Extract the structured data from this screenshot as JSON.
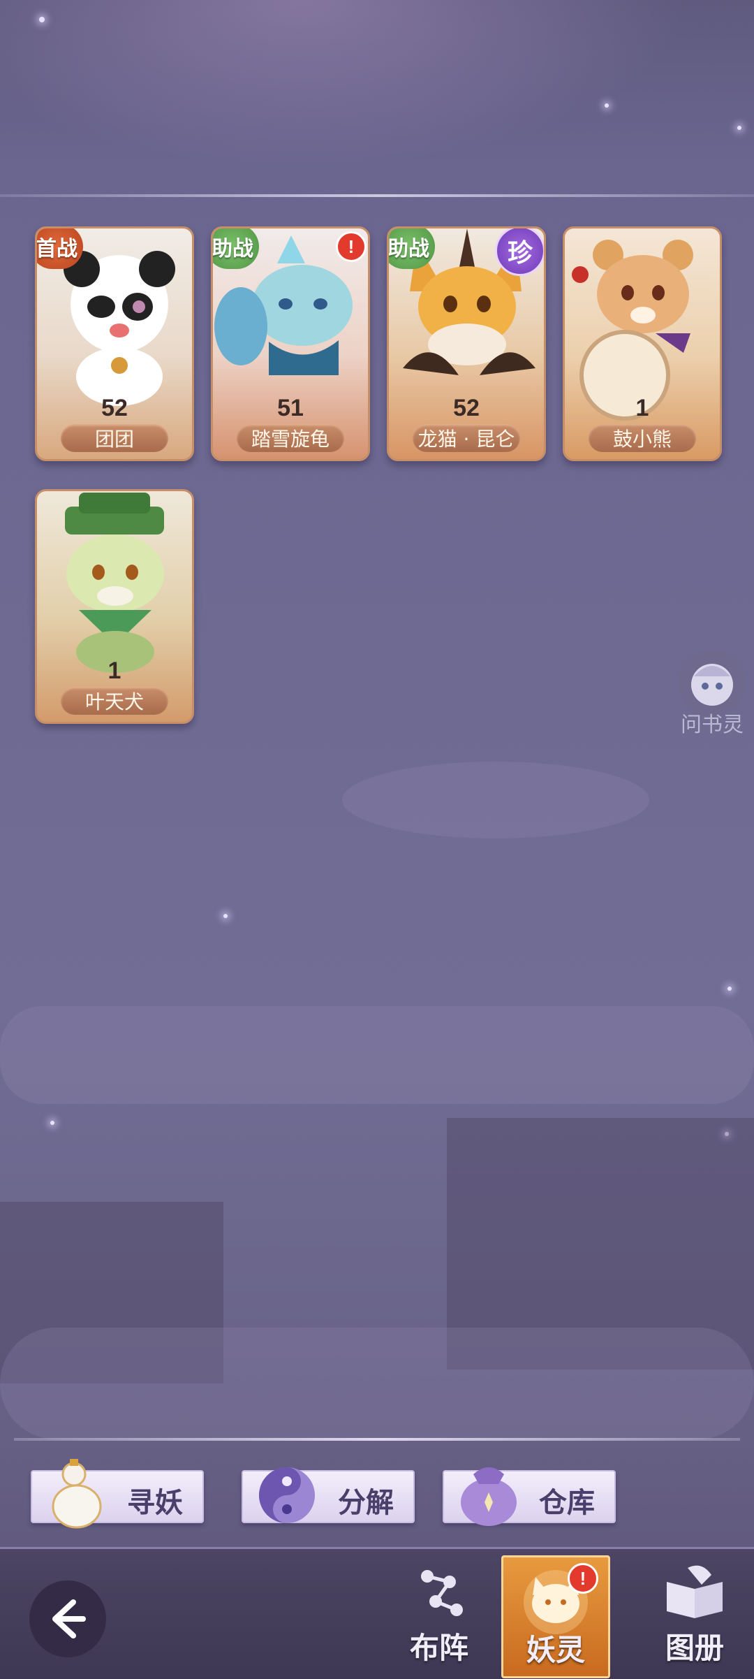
{
  "roster": [
    {
      "name": "团团",
      "level": "52",
      "tag": "首战",
      "tag_type": "first",
      "alert": "",
      "rare": ""
    },
    {
      "name": "踏雪旋龟",
      "level": "51",
      "tag": "助战",
      "tag_type": "assist",
      "alert": "!",
      "rare": ""
    },
    {
      "name": "龙猫 · 昆仑",
      "level": "52",
      "tag": "助战",
      "tag_type": "assist",
      "alert": "",
      "rare": "珍"
    },
    {
      "name": "鼓小熊",
      "level": "1",
      "tag": "",
      "tag_type": "",
      "alert": "",
      "rare": ""
    },
    {
      "name": "叶天犬",
      "level": "1",
      "tag": "",
      "tag_type": "",
      "alert": "",
      "rare": ""
    }
  ],
  "assistant": {
    "label": "问书灵",
    "icon": "spirit-face-icon"
  },
  "actions": [
    {
      "label": "寻妖",
      "icon": "gourd-icon"
    },
    {
      "label": "分解",
      "icon": "yin-yang-orb-icon"
    },
    {
      "label": "仓库",
      "icon": "bag-icon"
    }
  ],
  "nav": {
    "back_icon": "back-arrow-icon",
    "tabs": [
      {
        "label": "布阵",
        "icon": "formation-icon",
        "active": false
      },
      {
        "label": "妖灵",
        "icon": "cat-spirit-icon",
        "active": true,
        "alert": "!"
      },
      {
        "label": "图册",
        "icon": "book-icon",
        "active": false
      }
    ]
  },
  "colors": {
    "accent": "#c86a1f",
    "card_border": "#c68f6a",
    "alert": "#e23b2e",
    "rare": "#6d3bb8"
  }
}
